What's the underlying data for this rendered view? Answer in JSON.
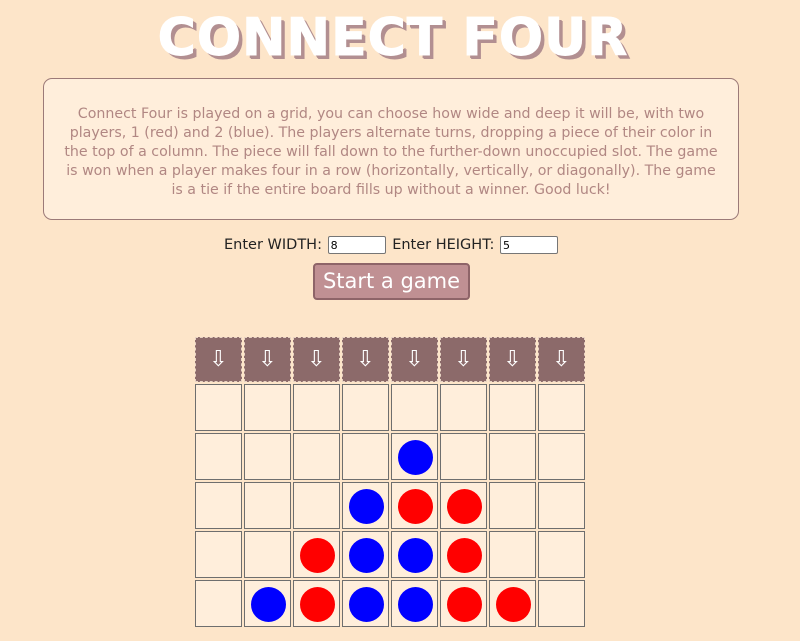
{
  "title": "CONNECT FOUR",
  "rules": "Connect Four is played on a grid, you can choose how wide and deep it will be, with two players, 1 (red) and 2 (blue). The players alternate turns, dropping a piece of their color in the top of a column. The piece will fall down to the further-down unoccupied slot. The game is won when a player makes four in a row (horizontally, vertically, or diagonally). The game is a tie if the entire board fills up without a winner. Good luck!",
  "controls": {
    "width_label": "Enter WIDTH:",
    "width_value": "8",
    "height_label": "Enter HEIGHT:",
    "height_value": "5",
    "start_label": "Start a game"
  },
  "board": {
    "drop_icon": "⇩",
    "colors": {
      "red": "#ff0000",
      "blue": "#0000ff",
      "drop_button": "#8c6a6a",
      "cell_bg": "#ffeedb"
    },
    "rows": [
      [
        "",
        "",
        "",
        "",
        "",
        "",
        "",
        ""
      ],
      [
        "",
        "",
        "",
        "",
        "blue",
        "",
        "",
        ""
      ],
      [
        "",
        "",
        "",
        "blue",
        "red",
        "red",
        "",
        ""
      ],
      [
        "",
        "",
        "red",
        "blue",
        "blue",
        "red",
        "",
        ""
      ],
      [
        "",
        "blue",
        "red",
        "blue",
        "blue",
        "red",
        "red",
        ""
      ]
    ]
  }
}
